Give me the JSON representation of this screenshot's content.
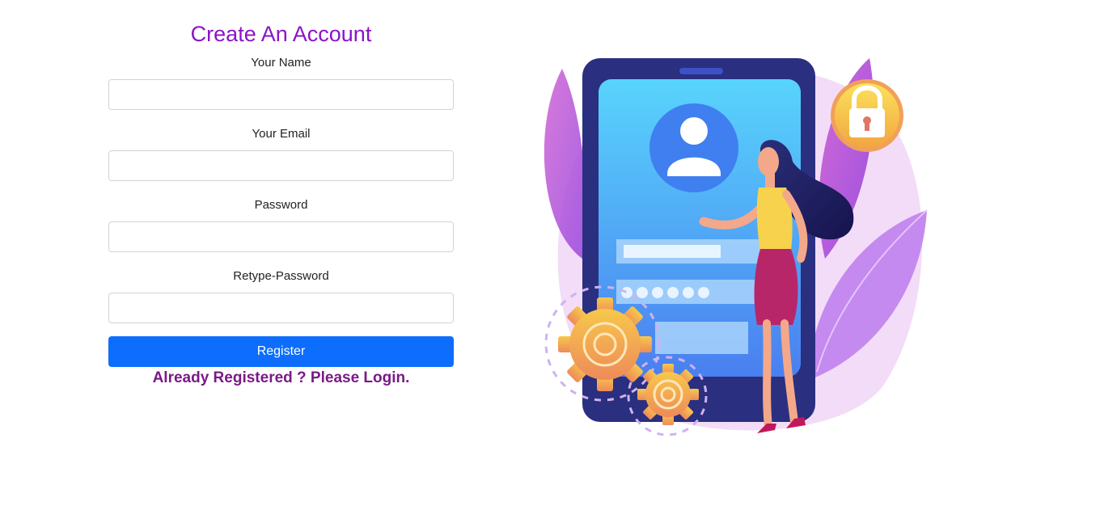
{
  "form": {
    "title": "Create An Account",
    "fields": [
      {
        "label": "Your Name",
        "value": "",
        "placeholder": ""
      },
      {
        "label": "Your Email",
        "value": "",
        "placeholder": ""
      },
      {
        "label": "Password",
        "value": "",
        "placeholder": ""
      },
      {
        "label": "Retype-Password",
        "value": "",
        "placeholder": ""
      }
    ],
    "submit_label": "Register",
    "login_link": "Already Registered ? Please Login."
  },
  "colors": {
    "title": "#8b14c9",
    "button": "#0d6efd",
    "link": "#7a1a86"
  },
  "illustration": {
    "icons": [
      "phone-icon",
      "user-avatar-icon",
      "padlock-icon",
      "gear-icon",
      "woman-figure"
    ]
  }
}
